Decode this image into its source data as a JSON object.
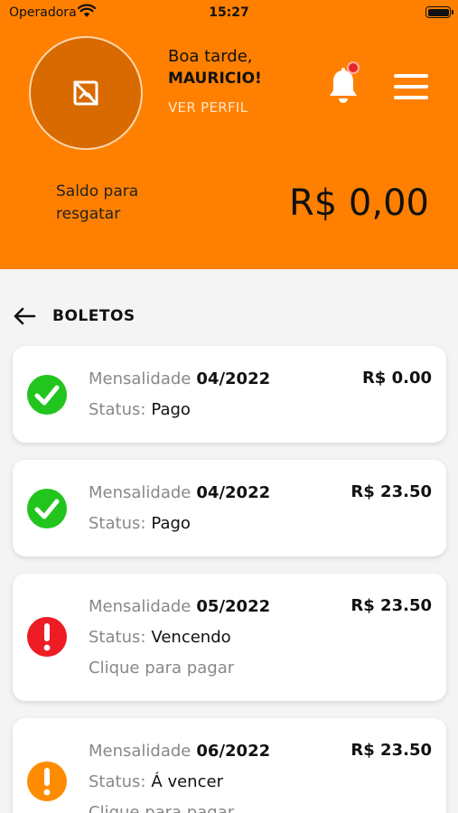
{
  "status_bar": {
    "carrier": "Operadora",
    "time": "15:27"
  },
  "header": {
    "greeting": "Boa tarde,",
    "user_name": "MAURICIO!",
    "profile_link": "VER PERFIL",
    "balance_label": "Saldo para resgatar",
    "balance_value": "R$ 0,00"
  },
  "section": {
    "title": "BOLETOS"
  },
  "boletos": [
    {
      "title_label": "Mensalidade",
      "period": "04/2022",
      "status_label": "Status:",
      "status": "Pago",
      "amount": "R$ 0.00",
      "hint": "",
      "icon": "check-circle-icon",
      "color": "#22c51e"
    },
    {
      "title_label": "Mensalidade",
      "period": "04/2022",
      "status_label": "Status:",
      "status": "Pago",
      "amount": "R$ 23.50",
      "hint": "",
      "icon": "check-circle-icon",
      "color": "#22c51e"
    },
    {
      "title_label": "Mensalidade",
      "period": "05/2022",
      "status_label": "Status:",
      "status": "Vencendo",
      "amount": "R$ 23.50",
      "hint": "Clique para pagar",
      "icon": "alert-circle-icon",
      "color": "#ee1c24"
    },
    {
      "title_label": "Mensalidade",
      "period": "06/2022",
      "status_label": "Status:",
      "status": "Á vencer",
      "amount": "R$ 23.50",
      "hint": "Clique para pagar",
      "icon": "alert-circle-icon",
      "color": "#ff8c00"
    }
  ],
  "colors": {
    "primary": "#ff8000",
    "paid": "#22c51e",
    "due": "#ee1c24",
    "upcoming": "#ff8c00"
  }
}
